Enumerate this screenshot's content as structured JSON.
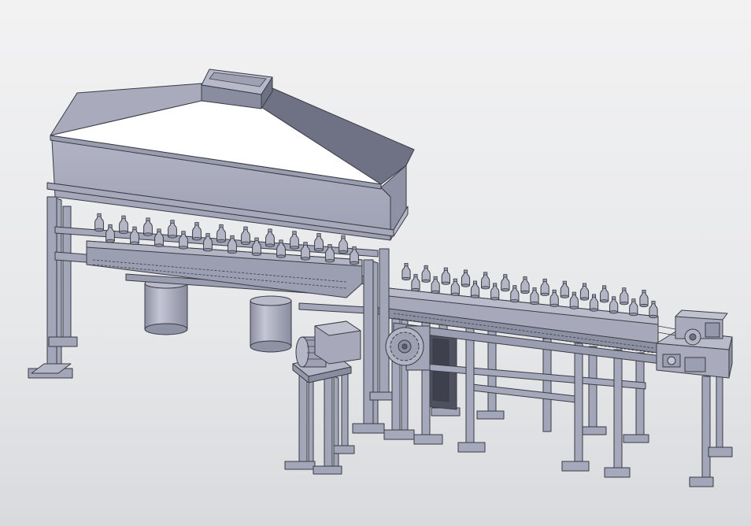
{
  "view": {
    "background_top": "#f2f2f3",
    "background_bottom": "#d9dadd",
    "model_color": "#a9abbd",
    "model_shadow": "#7c7e90",
    "edge_color": "#3a3c44"
  },
  "bottles": {
    "hopper_row_count": 11,
    "conveyor_row_count": 13
  }
}
